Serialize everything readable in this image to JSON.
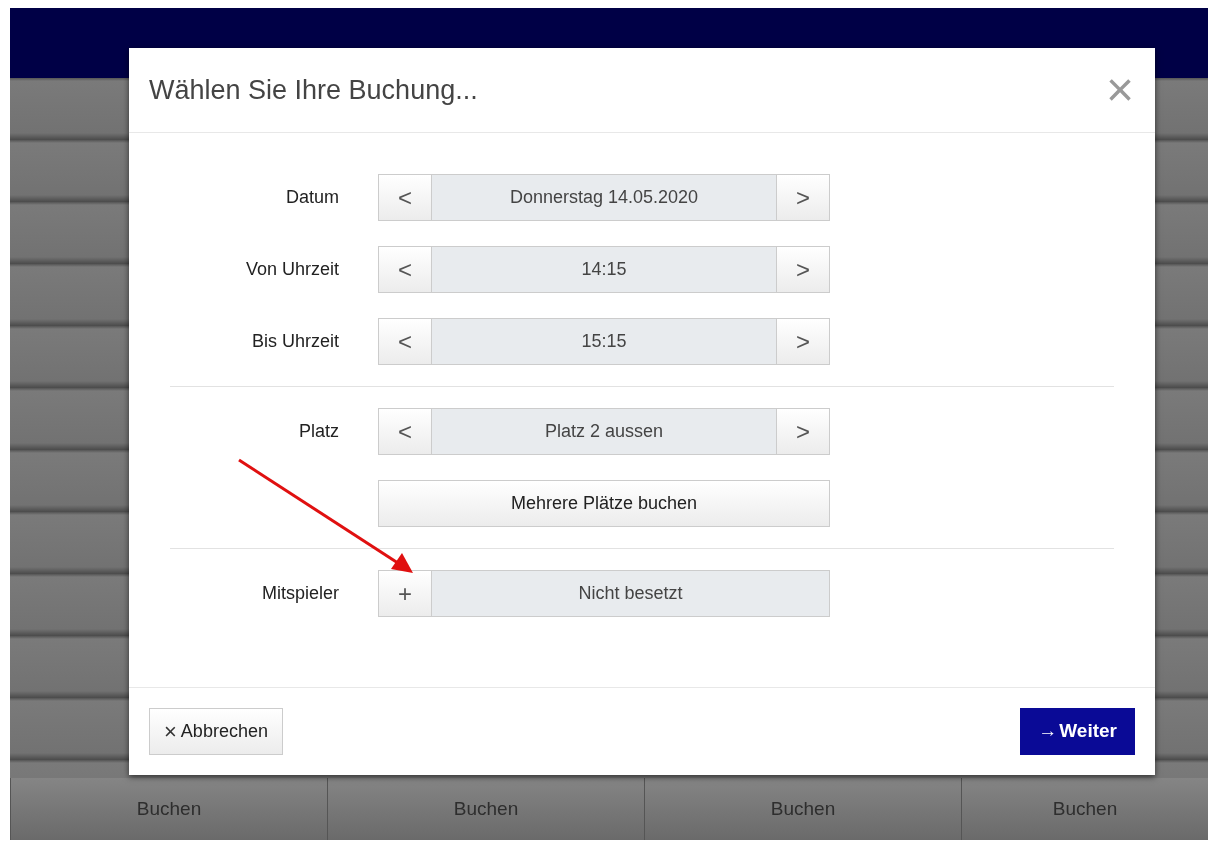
{
  "dialog": {
    "title": "Wählen Sie Ihre Buchung...",
    "close": "×",
    "sections": [
      [
        {
          "kind": "stepper",
          "label": "Datum",
          "prev": "<",
          "value": "Donnerstag 14.05.2020",
          "next": ">"
        },
        {
          "kind": "stepper",
          "label": "Von Uhrzeit",
          "prev": "<",
          "value": "14:15",
          "next": ">"
        },
        {
          "kind": "stepper",
          "label": "Bis Uhrzeit",
          "prev": "<",
          "value": "15:15",
          "next": ">"
        }
      ],
      [
        {
          "kind": "stepper",
          "label": "Platz",
          "prev": "<",
          "value": "Platz 2 aussen",
          "next": ">"
        },
        {
          "kind": "button",
          "label": "Mehrere Plätze buchen"
        }
      ],
      [
        {
          "kind": "adder",
          "label": "Mitspieler",
          "add": "+",
          "value": "Nicht besetzt"
        }
      ]
    ],
    "cancel": {
      "icon": "×",
      "label": "Abbrechen"
    },
    "next": {
      "icon": "→",
      "label": "Weiter"
    }
  },
  "background": {
    "buttons": [
      "Buchen",
      "Buchen",
      "Buchen",
      "Buchen"
    ]
  }
}
